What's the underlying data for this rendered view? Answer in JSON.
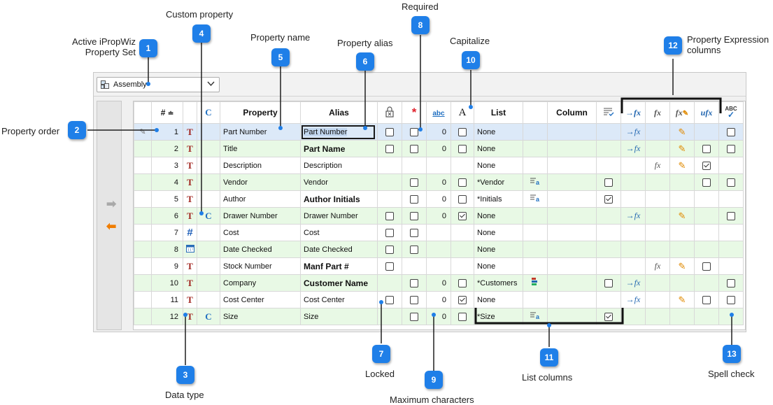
{
  "property_set": {
    "label": "Assembly"
  },
  "headers": {
    "order": "#",
    "property": "Property",
    "alias": "Alias",
    "list": "List",
    "column": "Column",
    "custom_icon": "C",
    "max_chars_icon": "abc",
    "capitalize_icon": "A",
    "spell_icon": "ABC"
  },
  "rows": [
    {
      "n": "1",
      "type": "text",
      "custom": "",
      "property": "Part Number",
      "alias": "Part Number",
      "alias_bold": false,
      "locked": "off",
      "required": "off",
      "max": "0",
      "cap": "off",
      "list": "None",
      "list_icon": "",
      "colchk": "",
      "fx1": "assign",
      "fx2": "",
      "fx3": "pen",
      "fx4": "",
      "spell": "off",
      "style": "sel"
    },
    {
      "n": "2",
      "type": "text",
      "custom": "",
      "property": "Title",
      "alias": "Part Name",
      "alias_bold": true,
      "locked": "off",
      "required": "off",
      "max": "0",
      "cap": "off",
      "list": "None",
      "list_icon": "",
      "colchk": "",
      "fx1": "assign",
      "fx2": "",
      "fx3": "pen",
      "fx4": "off",
      "spell": "off",
      "style": "g"
    },
    {
      "n": "3",
      "type": "text",
      "custom": "",
      "property": "Description",
      "alias": "Description",
      "alias_bold": false,
      "locked": "",
      "required": "",
      "max": "",
      "cap": "",
      "list": "None",
      "list_icon": "",
      "colchk": "",
      "fx1": "",
      "fx2": "fx",
      "fx3": "pen",
      "fx4": "on",
      "spell": "",
      "style": ""
    },
    {
      "n": "4",
      "type": "text",
      "custom": "",
      "property": "Vendor",
      "alias": "Vendor",
      "alias_bold": false,
      "locked": "",
      "required": "off",
      "max": "0",
      "cap": "off",
      "list": "*Vendor",
      "list_icon": "list",
      "colchk": "off",
      "fx1": "",
      "fx2": "",
      "fx3": "",
      "fx4": "off",
      "spell": "off",
      "style": "g"
    },
    {
      "n": "5",
      "type": "text",
      "custom": "",
      "property": "Author",
      "alias": "Author Initials",
      "alias_bold": true,
      "locked": "",
      "required": "off",
      "max": "0",
      "cap": "off",
      "list": "*Initials",
      "list_icon": "list",
      "colchk": "on",
      "fx1": "",
      "fx2": "",
      "fx3": "",
      "fx4": "",
      "spell": "",
      "style": ""
    },
    {
      "n": "6",
      "type": "text",
      "custom": "C",
      "property": "Drawer Number",
      "alias": "Drawer Number",
      "alias_bold": false,
      "locked": "off",
      "required": "off",
      "max": "0",
      "cap": "on",
      "list": "None",
      "list_icon": "",
      "colchk": "",
      "fx1": "assign",
      "fx2": "",
      "fx3": "pen",
      "fx4": "",
      "spell": "off",
      "style": "g"
    },
    {
      "n": "7",
      "type": "number",
      "custom": "",
      "property": "Cost",
      "alias": "Cost",
      "alias_bold": false,
      "locked": "off",
      "required": "off",
      "max": "",
      "cap": "",
      "list": "None",
      "list_icon": "",
      "colchk": "",
      "fx1": "",
      "fx2": "",
      "fx3": "",
      "fx4": "",
      "spell": "",
      "style": ""
    },
    {
      "n": "8",
      "type": "date",
      "custom": "",
      "property": "Date Checked",
      "alias": "Date Checked",
      "alias_bold": false,
      "locked": "off",
      "required": "off",
      "max": "",
      "cap": "",
      "list": "None",
      "list_icon": "",
      "colchk": "",
      "fx1": "",
      "fx2": "",
      "fx3": "",
      "fx4": "",
      "spell": "",
      "style": "g"
    },
    {
      "n": "9",
      "type": "text",
      "custom": "",
      "property": "Stock Number",
      "alias": "Manf Part #",
      "alias_bold": true,
      "locked": "off",
      "required": "",
      "max": "",
      "cap": "",
      "list": "None",
      "list_icon": "",
      "colchk": "",
      "fx1": "",
      "fx2": "fx",
      "fx3": "pen",
      "fx4": "off",
      "spell": "",
      "style": ""
    },
    {
      "n": "10",
      "type": "text",
      "custom": "",
      "property": "Company",
      "alias": "Customer Name",
      "alias_bold": true,
      "locked": "",
      "required": "off",
      "max": "0",
      "cap": "off",
      "list": "*Customers",
      "list_icon": "combo",
      "colchk": "off",
      "fx1": "assign",
      "fx2": "",
      "fx3": "",
      "fx4": "",
      "spell": "off",
      "style": "g"
    },
    {
      "n": "11",
      "type": "text",
      "custom": "",
      "property": "Cost Center",
      "alias": "Cost Center",
      "alias_bold": false,
      "locked": "off",
      "required": "off",
      "max": "0",
      "cap": "on",
      "list": "None",
      "list_icon": "",
      "colchk": "",
      "fx1": "assign",
      "fx2": "",
      "fx3": "pen",
      "fx4": "off",
      "spell": "off",
      "style": ""
    },
    {
      "n": "12",
      "type": "text",
      "custom": "C",
      "property": "Size",
      "alias": "Size",
      "alias_bold": false,
      "locked": "",
      "required": "off",
      "max": "0",
      "cap": "off",
      "list": "*Size",
      "list_icon": "list",
      "colchk": "on",
      "fx1": "",
      "fx2": "",
      "fx3": "",
      "fx4": "",
      "spell": "",
      "style": "g"
    }
  ],
  "annotations": {
    "a1": "Active iPropWiz Property Set",
    "a2": "Property order",
    "a3": "Data type",
    "a4": "Custom property",
    "a5": "Property name",
    "a6": "Property alias",
    "a7": "Locked",
    "a8": "Required",
    "a9": "Maximum characters",
    "a10": "Capitalize",
    "a11": "List columns",
    "a12": "Property Expression columns",
    "a13": "Spell check"
  },
  "badges": [
    "1",
    "2",
    "3",
    "4",
    "5",
    "6",
    "7",
    "8",
    "9",
    "10",
    "11",
    "12",
    "13"
  ],
  "colors": {
    "badge": "#1f7fe8",
    "green_row": "#e8f9e5",
    "selected_row": "#dce9f8",
    "arrow_right": "#a9a9a9",
    "arrow_left": "#f07d00"
  }
}
